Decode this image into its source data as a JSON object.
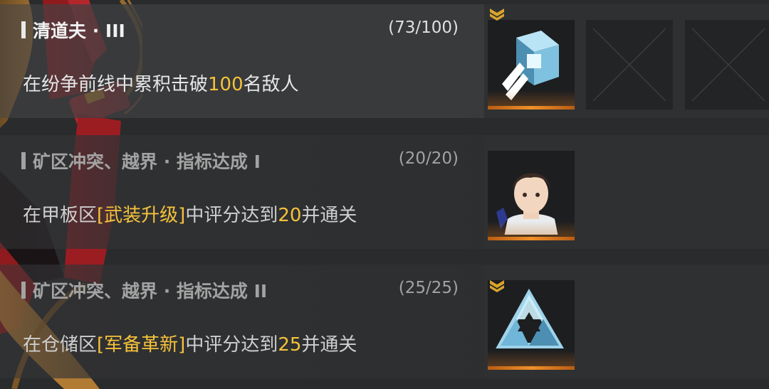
{
  "missions": [
    {
      "title": "清道夫 · III",
      "progress": "(73/100)",
      "desc_prefix": "在纷争前线中累积击破",
      "desc_highlight": "100",
      "desc_suffix": "名敌人",
      "reward_icon": "cube-crystal-icon",
      "has_badge": true,
      "completed": false
    },
    {
      "title": "矿区冲突、越界 · 指标达成 I",
      "progress": "(20/20)",
      "desc_prefix": "在甲板区",
      "desc_highlight": "[武装升级]",
      "desc_mid": "中评分达到",
      "desc_number": "20",
      "desc_suffix": "并通关",
      "reward_icon": "character-portrait-icon",
      "has_badge": false,
      "completed": true
    },
    {
      "title": "矿区冲突、越界 · 指标达成 II",
      "progress": "(25/25)",
      "desc_prefix": "在仓储区",
      "desc_highlight": "[军备革新]",
      "desc_mid": "中评分达到",
      "desc_number": "25",
      "desc_suffix": "并通关",
      "reward_icon": "triangle-crystal-icon",
      "has_badge": true,
      "completed": true
    }
  ],
  "colors": {
    "highlight": "#f5c23a",
    "reward_underline": "#f0902a",
    "background": "#2a2b2d"
  }
}
